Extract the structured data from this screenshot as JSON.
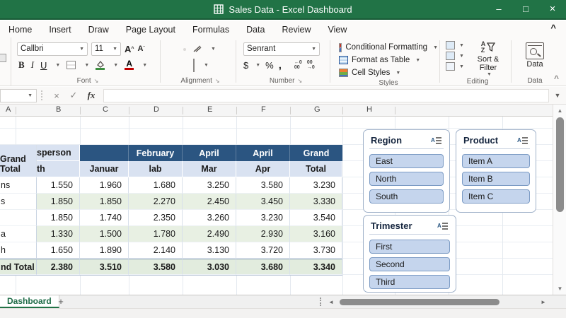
{
  "window": {
    "title": "Sales Data - Excel Dashboard"
  },
  "ribbon_tabs": [
    "Home",
    "Insert",
    "Draw",
    "Page Layout",
    "Formulas",
    "Data",
    "Review",
    "View"
  ],
  "font_group": {
    "font_name": "Callbri",
    "font_size": "11",
    "label": "Font"
  },
  "alignment_group": {
    "label": "Alignment"
  },
  "number_group": {
    "format": "Senrant",
    "label": "Number"
  },
  "styles_group": {
    "items": [
      "Conditional Formatting",
      "Format as Table",
      "Cell Styles"
    ],
    "label": "Styles"
  },
  "editing_group": {
    "sort_filter": "Sort & Filter",
    "label": "Editing"
  },
  "data_group": {
    "button": "Data",
    "label": "Data"
  },
  "formula_bar": {
    "value": ""
  },
  "columns": [
    "A",
    "B",
    "C",
    "D",
    "E",
    "F",
    "G",
    "H"
  ],
  "table": {
    "header_row1": {
      "a": "sperson",
      "cells": [
        "",
        "February",
        "April",
        "April",
        "Grand"
      ]
    },
    "header_row2": {
      "a": "th",
      "cells": [
        "Januar",
        "lab",
        "Mar",
        "Apr",
        "Total"
      ],
      "grand": "Grand Total"
    },
    "rows": [
      {
        "name": "ns",
        "values": [
          "1.550",
          "1.960",
          "1.680",
          "3.250",
          "3.580",
          "3.230"
        ]
      },
      {
        "name": "s",
        "values": [
          "1.850",
          "1.850",
          "2.270",
          "2.450",
          "3.450",
          "3.330"
        ]
      },
      {
        "name": "",
        "values": [
          "1.850",
          "1.740",
          "2.350",
          "3.260",
          "3.230",
          "3.540"
        ]
      },
      {
        "name": "a",
        "values": [
          "1.330",
          "1.500",
          "1.780",
          "2.490",
          "2.930",
          "3.160"
        ]
      },
      {
        "name": "h",
        "values": [
          "1.650",
          "1.890",
          "2.140",
          "3.130",
          "3.720",
          "3.730"
        ]
      }
    ],
    "total": {
      "name": "nd Total",
      "values": [
        "2.380",
        "3.510",
        "3.580",
        "3.030",
        "3.680",
        "3.340"
      ]
    }
  },
  "slicers": [
    {
      "title": "Region",
      "items": [
        "East",
        "North",
        "South"
      ]
    },
    {
      "title": "Product",
      "items": [
        "Item A",
        "Item B",
        "Item C"
      ]
    },
    {
      "title": "Trimester",
      "items": [
        "First",
        "Second",
        "Third"
      ]
    }
  ],
  "sheet_tabs": {
    "active": "Dashboard",
    "add_label": "+"
  },
  "colors": {
    "title_green": "#217346",
    "header_blue": "#2B5581",
    "header_lightblue": "#D9E2F1",
    "band_green": "#E8F0E3",
    "slicer_item_blue": "#C5D5ED"
  }
}
